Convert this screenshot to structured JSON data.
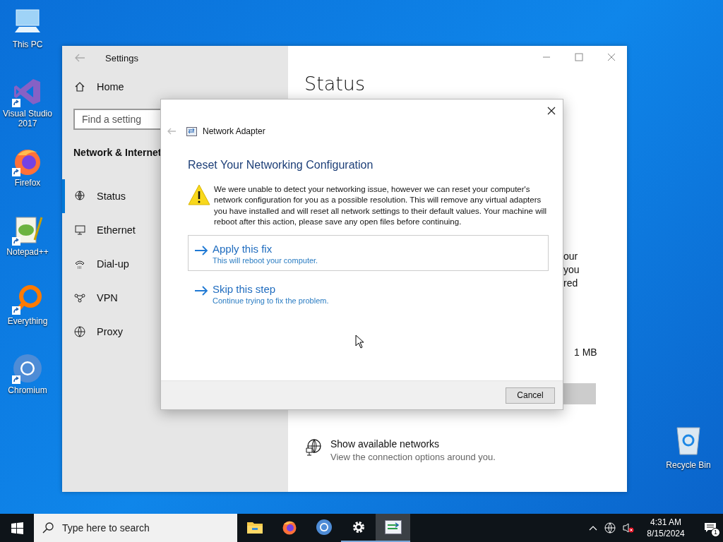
{
  "desktop_icons": [
    {
      "label": "This PC",
      "kind": "pc",
      "shortcut": false
    },
    {
      "label": "Visual Studio 2017",
      "kind": "vs",
      "shortcut": true
    },
    {
      "label": "Firefox",
      "kind": "firefox",
      "shortcut": true
    },
    {
      "label": "Notepad++",
      "kind": "notepad",
      "shortcut": true
    },
    {
      "label": "Everything",
      "kind": "everything",
      "shortcut": true
    },
    {
      "label": "Chromium",
      "kind": "chromium",
      "shortcut": true
    }
  ],
  "recycle_bin": {
    "label": "Recycle Bin"
  },
  "settings_window": {
    "title": "Settings",
    "sidebar": {
      "home": "Home",
      "search": {
        "placeholder": "Find a setting"
      },
      "section": "Network & Internet",
      "items": [
        {
          "label": "Status",
          "kind": "status",
          "selected": true
        },
        {
          "label": "Ethernet",
          "kind": "ethernet",
          "selected": false
        },
        {
          "label": "Dial-up",
          "kind": "dialup",
          "selected": false
        },
        {
          "label": "VPN",
          "kind": "vpn",
          "selected": false
        },
        {
          "label": "Proxy",
          "kind": "proxy",
          "selected": false
        }
      ]
    },
    "content": {
      "title": "Status",
      "fragments": [
        "our",
        "you",
        "red"
      ],
      "size": "1 MB",
      "available_networks": {
        "title": "Show available networks",
        "subtitle": "View the connection options around you."
      }
    }
  },
  "dialog": {
    "title": "Network Adapter",
    "heading": "Reset Your Networking Configuration",
    "message": "We were unable to detect your networking issue, however we can reset your computer's network configuration for you as a possible resolution. This will remove any virtual adapters you have installed and will reset all network settings to their default values. Your machine will reboot after this action, please save any open files before continuing.",
    "options": [
      {
        "title": "Apply this fix",
        "subtitle": "This will reboot your computer.",
        "selected": true
      },
      {
        "title": "Skip this step",
        "subtitle": "Continue trying to fix the problem.",
        "selected": false
      }
    ],
    "buttons": [
      "Cancel"
    ]
  },
  "taskbar": {
    "search": {
      "placeholder": "Type here to search"
    },
    "apps": [
      {
        "kind": "explorer",
        "running": false,
        "active": false
      },
      {
        "kind": "firefox",
        "running": false,
        "active": false
      },
      {
        "kind": "chromium",
        "running": false,
        "active": false
      },
      {
        "kind": "settings",
        "running": true,
        "active": false
      },
      {
        "kind": "network",
        "running": true,
        "active": true
      }
    ],
    "time": "4:31 AM",
    "date": "8/15/2024",
    "notifications": "1"
  }
}
